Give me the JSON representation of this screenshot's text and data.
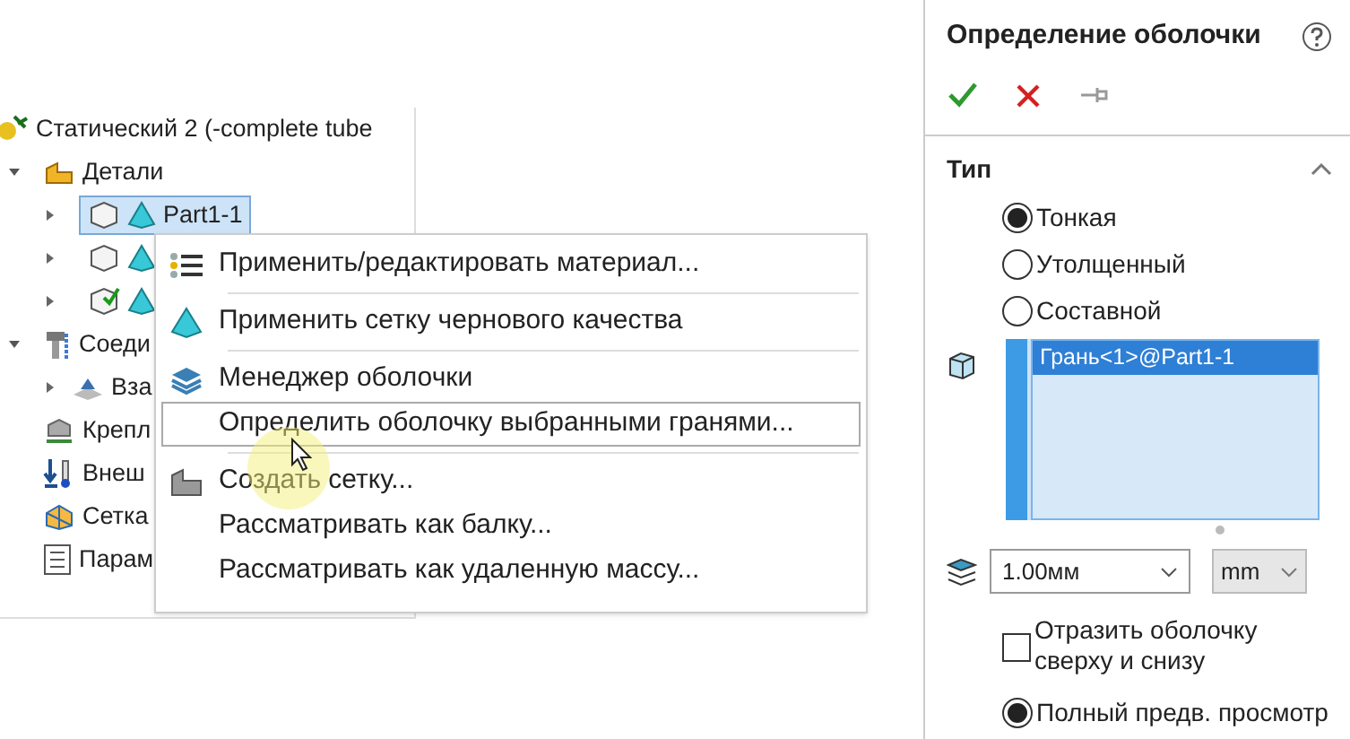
{
  "tree": {
    "root": "Статический 2 (-complete tube",
    "items": [
      {
        "label": "Детали",
        "expanded": true,
        "children": [
          {
            "label": "Part1-1",
            "selected": true,
            "checked": false
          },
          {
            "selected": false,
            "checked": false
          },
          {
            "selected": false,
            "checked": true
          }
        ]
      },
      {
        "label": "Соеди",
        "expanded": true,
        "children": [
          {
            "label": "Вза"
          }
        ]
      },
      {
        "label": "Крепл"
      },
      {
        "label": "Внеш"
      },
      {
        "label": "Сетка"
      },
      {
        "label": "Парам"
      }
    ]
  },
  "context_menu": [
    {
      "kind": "item",
      "label": "Применить/редактировать материал...",
      "highlighted": false
    },
    {
      "kind": "separator"
    },
    {
      "kind": "item",
      "label": "Применить сетку чернового качества",
      "highlighted": false
    },
    {
      "kind": "separator"
    },
    {
      "kind": "item",
      "label": "Менеджер оболочки",
      "highlighted": false
    },
    {
      "kind": "item",
      "label": "Определить оболочку выбранными гранями...",
      "highlighted": true
    },
    {
      "kind": "separator"
    },
    {
      "kind": "item",
      "label": "Создать сетку...",
      "highlighted": false
    },
    {
      "kind": "item",
      "label": "Рассматривать как балку...",
      "highlighted": false
    },
    {
      "kind": "item",
      "label": "Рассматривать как удаленную массу...",
      "highlighted": false
    }
  ],
  "property_panel": {
    "title": "Определение оболочки",
    "section": "Тип",
    "section_expanded": true,
    "types": [
      {
        "label": "Тонкая",
        "selected": true
      },
      {
        "label": "Утолщенный",
        "selected": false
      },
      {
        "label": "Составной",
        "selected": false
      }
    ],
    "faces": [
      {
        "label": "Грань<1>@Part1-1",
        "selected": true
      }
    ],
    "thickness": "1.00мм",
    "unit": "mm",
    "unit_disabled": true,
    "flip": {
      "label": "Отразить оболочку сверху и снизу",
      "checked": false
    },
    "preview": {
      "label": "Полный предв. просмотр",
      "checked": true
    }
  }
}
